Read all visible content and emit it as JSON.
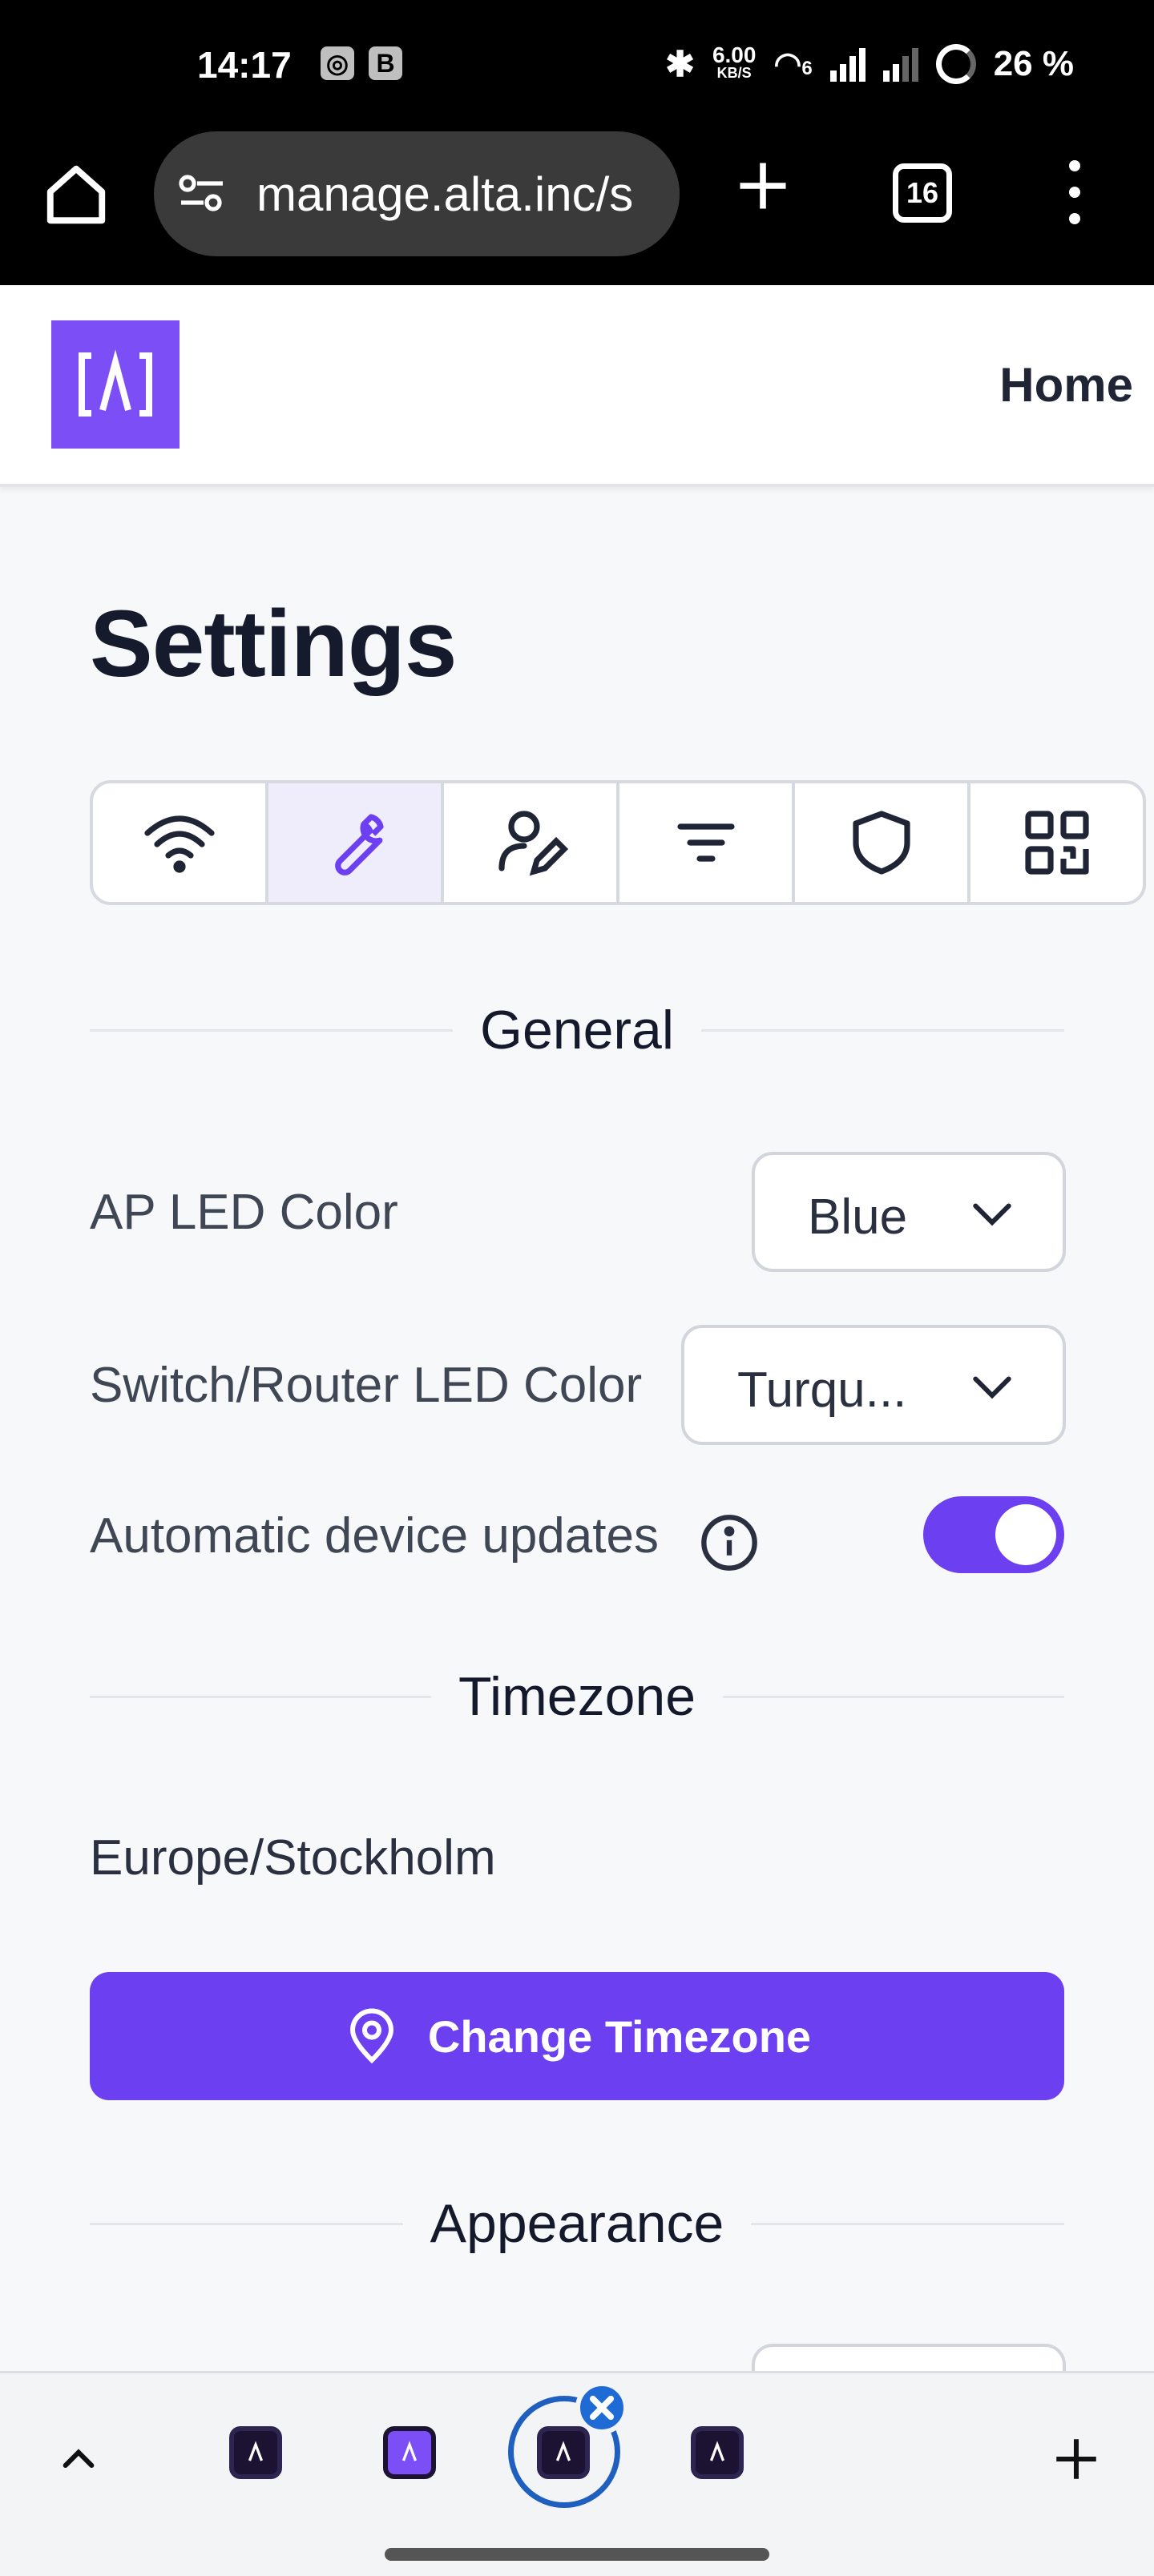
{
  "status_bar": {
    "time": "14:17",
    "badge_b": "B",
    "net_speed_value": "6.00",
    "net_speed_unit": "KB/S",
    "wifi_label": "6",
    "battery": "26 %"
  },
  "browser": {
    "url": "manage.alta.inc/s",
    "tab_count": "16"
  },
  "app": {
    "logo_icon": "alta-logo-icon",
    "nav_home": "Home"
  },
  "page": {
    "title": "Settings",
    "tabs": [
      {
        "icon": "wifi-icon",
        "active": false
      },
      {
        "icon": "wrench-icon",
        "active": true
      },
      {
        "icon": "user-edit-icon",
        "active": false
      },
      {
        "icon": "filter-icon",
        "active": false
      },
      {
        "icon": "shield-icon",
        "active": false
      },
      {
        "icon": "qr-scan-icon",
        "active": false
      }
    ],
    "general": {
      "heading": "General",
      "ap_led_label": "AP LED Color",
      "ap_led_value": "Blue",
      "switch_led_label": "Switch/Router LED Color",
      "switch_led_value": "Turqu...",
      "auto_updates_label": "Automatic device updates",
      "auto_updates_enabled": true
    },
    "timezone": {
      "heading": "Timezone",
      "value": "Europe/Stockholm",
      "button_label": "Change Timezone"
    },
    "appearance": {
      "heading": "Appearance"
    }
  },
  "colors": {
    "accent": "#6c3ff0",
    "logo": "#7b4ff5",
    "active_tab_bg": "#efedfb"
  }
}
